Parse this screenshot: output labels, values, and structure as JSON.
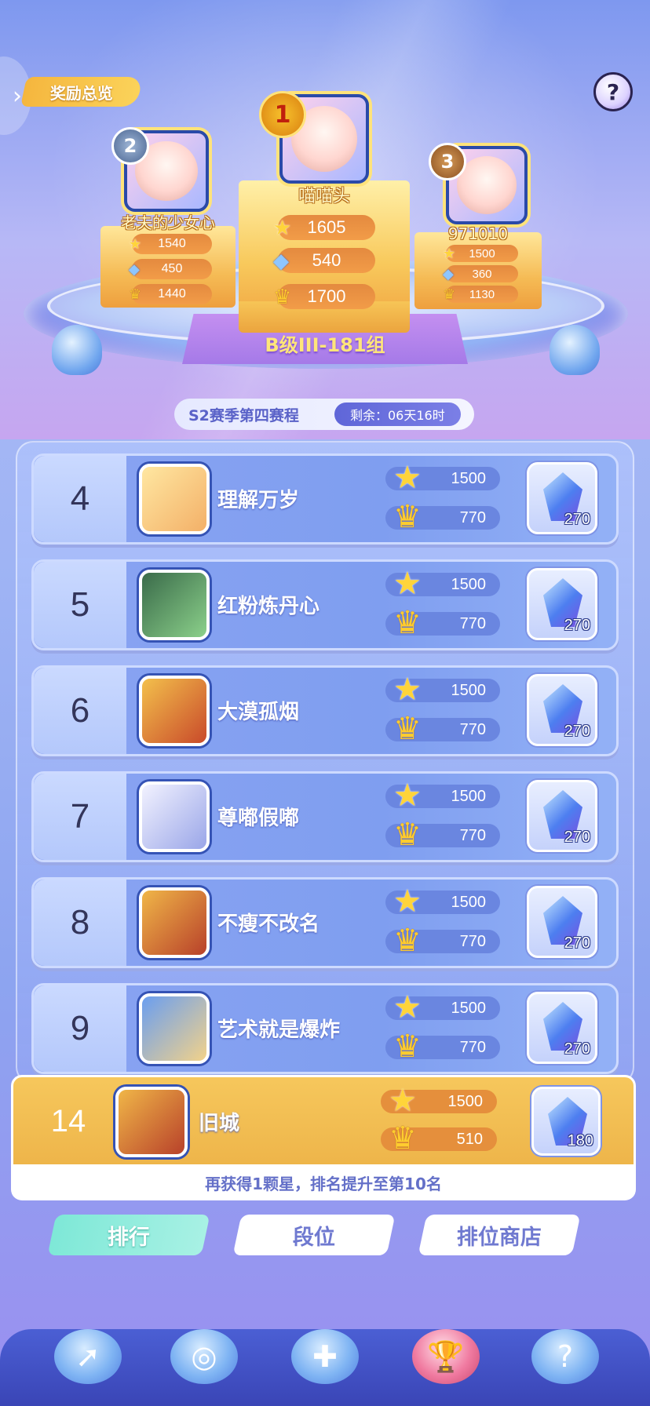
{
  "header": {
    "reward_overview": "奖励总览",
    "help": "?"
  },
  "podium": {
    "first": {
      "rank": "1",
      "name": "喵喵头",
      "stars": "1605",
      "gems": "540",
      "crowns": "1700"
    },
    "second": {
      "rank": "2",
      "name": "老夫的少女心",
      "stars": "1540",
      "gems": "450",
      "crowns": "1440"
    },
    "third": {
      "rank": "3",
      "name": "971010",
      "stars": "1500",
      "gems": "360",
      "crowns": "1130"
    },
    "group": "B级III-181组"
  },
  "season": {
    "title": "S2赛季第四赛程",
    "remaining": "剩余：06天16时"
  },
  "rows": [
    {
      "rank": "4",
      "name": "理解万岁",
      "stars": "1500",
      "crowns": "770",
      "reward": "270"
    },
    {
      "rank": "5",
      "name": "红粉炼丹心",
      "stars": "1500",
      "crowns": "770",
      "reward": "270"
    },
    {
      "rank": "6",
      "name": "大漠孤烟",
      "stars": "1500",
      "crowns": "770",
      "reward": "270"
    },
    {
      "rank": "7",
      "name": "尊嘟假嘟",
      "stars": "1500",
      "crowns": "770",
      "reward": "270"
    },
    {
      "rank": "8",
      "name": "不瘦不改名",
      "stars": "1500",
      "crowns": "770",
      "reward": "270"
    },
    {
      "rank": "9",
      "name": "艺术就是爆炸",
      "stars": "1500",
      "crowns": "770",
      "reward": "270"
    }
  ],
  "me": {
    "rank": "14",
    "name": "旧城",
    "stars": "1500",
    "crowns": "510",
    "reward": "180"
  },
  "hint": "再获得1颗星，排名提升至第10名",
  "tabs": {
    "rank": "排行",
    "tier": "段位",
    "shop": "排位商店"
  },
  "icons": {
    "star": "star-icon",
    "gem": "gem-icon",
    "crown": "crown-icon"
  },
  "colors": {
    "accent_gold": "#f6c75c",
    "tab_active": "#7ee8d7",
    "row_blue": "#8aa4f2"
  }
}
